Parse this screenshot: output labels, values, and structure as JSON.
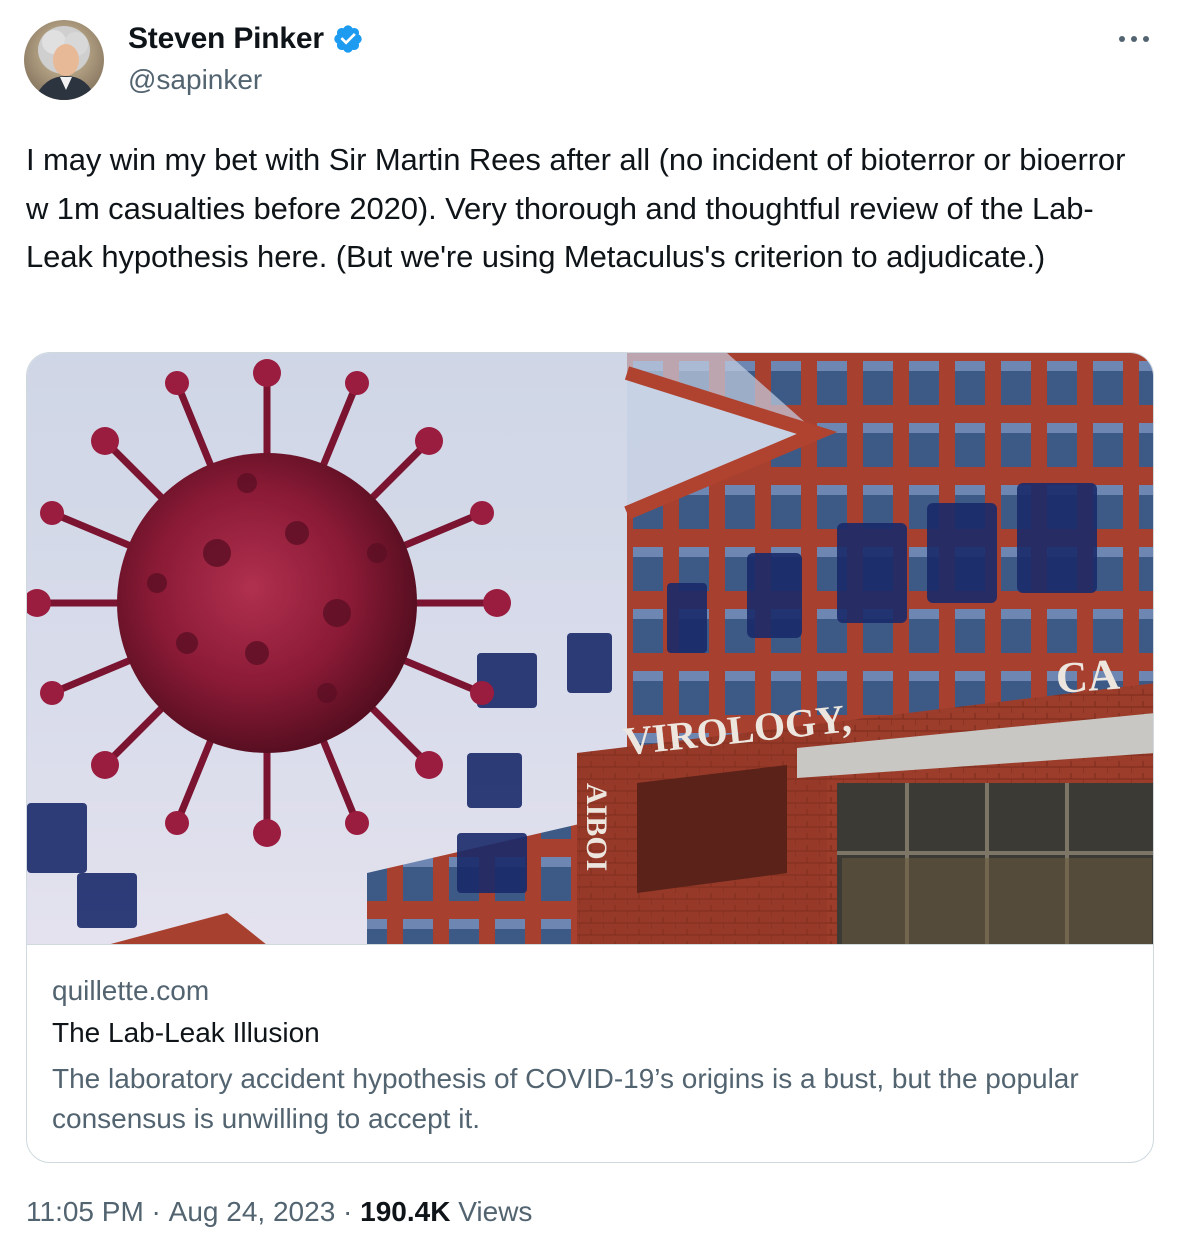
{
  "author": {
    "display_name": "Steven Pinker",
    "handle": "@sapinker",
    "verified_icon": "verified-badge-icon",
    "avatar_icon": "profile-photo"
  },
  "more_icon": "more-options-icon",
  "tweet": {
    "text": "I may win my bet with Sir Martin Rees after all (no incident of bioterror or bioerror w 1m casualties before 2020). Very thorough and thoughtful review of the Lab-Leak hypothesis here. (But we're using Metaculus's criterion to adjudicate.)"
  },
  "card": {
    "image_signs": {
      "virology": "VIROLOGY,",
      "ca": "CA",
      "vertical": "AIBOI"
    },
    "domain": "quillette.com",
    "title": "The Lab-Leak Illusion",
    "description": "The laboratory accident hypothesis of COVID-19’s origins is a bust, but the popular consensus is unwilling to accept it."
  },
  "meta": {
    "time": "11:05 PM",
    "separator": " · ",
    "date": "Aug 24, 2023",
    "separator2": " · ",
    "views_count": "190.4K",
    "views_label": " Views"
  },
  "colors": {
    "text_primary": "#0f1419",
    "text_secondary": "#536471",
    "verified": "#1d9bf0",
    "border": "#cfd9de"
  }
}
